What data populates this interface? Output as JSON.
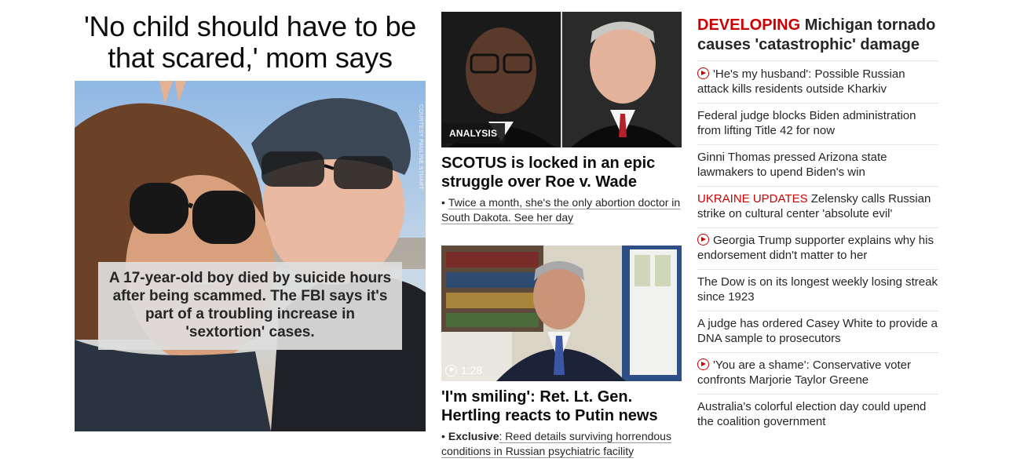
{
  "lead": {
    "headline": "'No child should have to be that scared,' mom says",
    "photo_credit": "COURTESY PAULINE STUART",
    "caption": "A 17-year-old boy died by suicide hours after being scammed. The FBI says it's part of a troubling increase in 'sextortion' cases."
  },
  "middle": {
    "card1": {
      "tag": "ANALYSIS",
      "headline": "SCOTUS is locked in an epic struggle over Roe v. Wade",
      "related": "Twice a month, she's the only abortion doctor in South Dakota. See her day"
    },
    "card2": {
      "video_duration": "1:28",
      "headline": "'I'm smiling': Ret. Lt. Gen. Hertling reacts to Putin news",
      "related_label": "Exclusive",
      "related": ": Reed details surviving horrendous conditions in Russian psychiatric facility"
    }
  },
  "right": {
    "top_label": "DEVELOPING",
    "top_headline": "Michigan tornado causes 'catastrophic' damage",
    "items": [
      {
        "video": true,
        "label": "",
        "text": "'He's my husband': Possible Russian attack kills residents outside Kharkiv"
      },
      {
        "video": false,
        "label": "",
        "text": "Federal judge blocks Biden administration from lifting Title 42 for now"
      },
      {
        "video": false,
        "label": "",
        "text": "Ginni Thomas pressed Arizona state lawmakers to upend Biden's win"
      },
      {
        "video": false,
        "label": "UKRAINE UPDATES",
        "text": "Zelensky calls Russian strike on cultural center 'absolute evil'"
      },
      {
        "video": true,
        "label": "",
        "text": "Georgia Trump supporter explains why his endorsement didn't matter to her"
      },
      {
        "video": false,
        "label": "",
        "text": "The Dow is on its longest weekly losing streak since 1923"
      },
      {
        "video": false,
        "label": "",
        "text": "A judge has ordered Casey White to provide a DNA sample to prosecutors"
      },
      {
        "video": true,
        "label": "",
        "text": "'You are a shame': Conservative voter confronts Marjorie Taylor Greene"
      },
      {
        "video": false,
        "label": "",
        "text": "Australia's colorful election day could upend the coalition government"
      }
    ]
  },
  "colors": {
    "accent_red": "#cc0000",
    "text": "#262626",
    "divider": "#e6e6e6"
  },
  "icons": {
    "video": "play-circle-icon"
  }
}
